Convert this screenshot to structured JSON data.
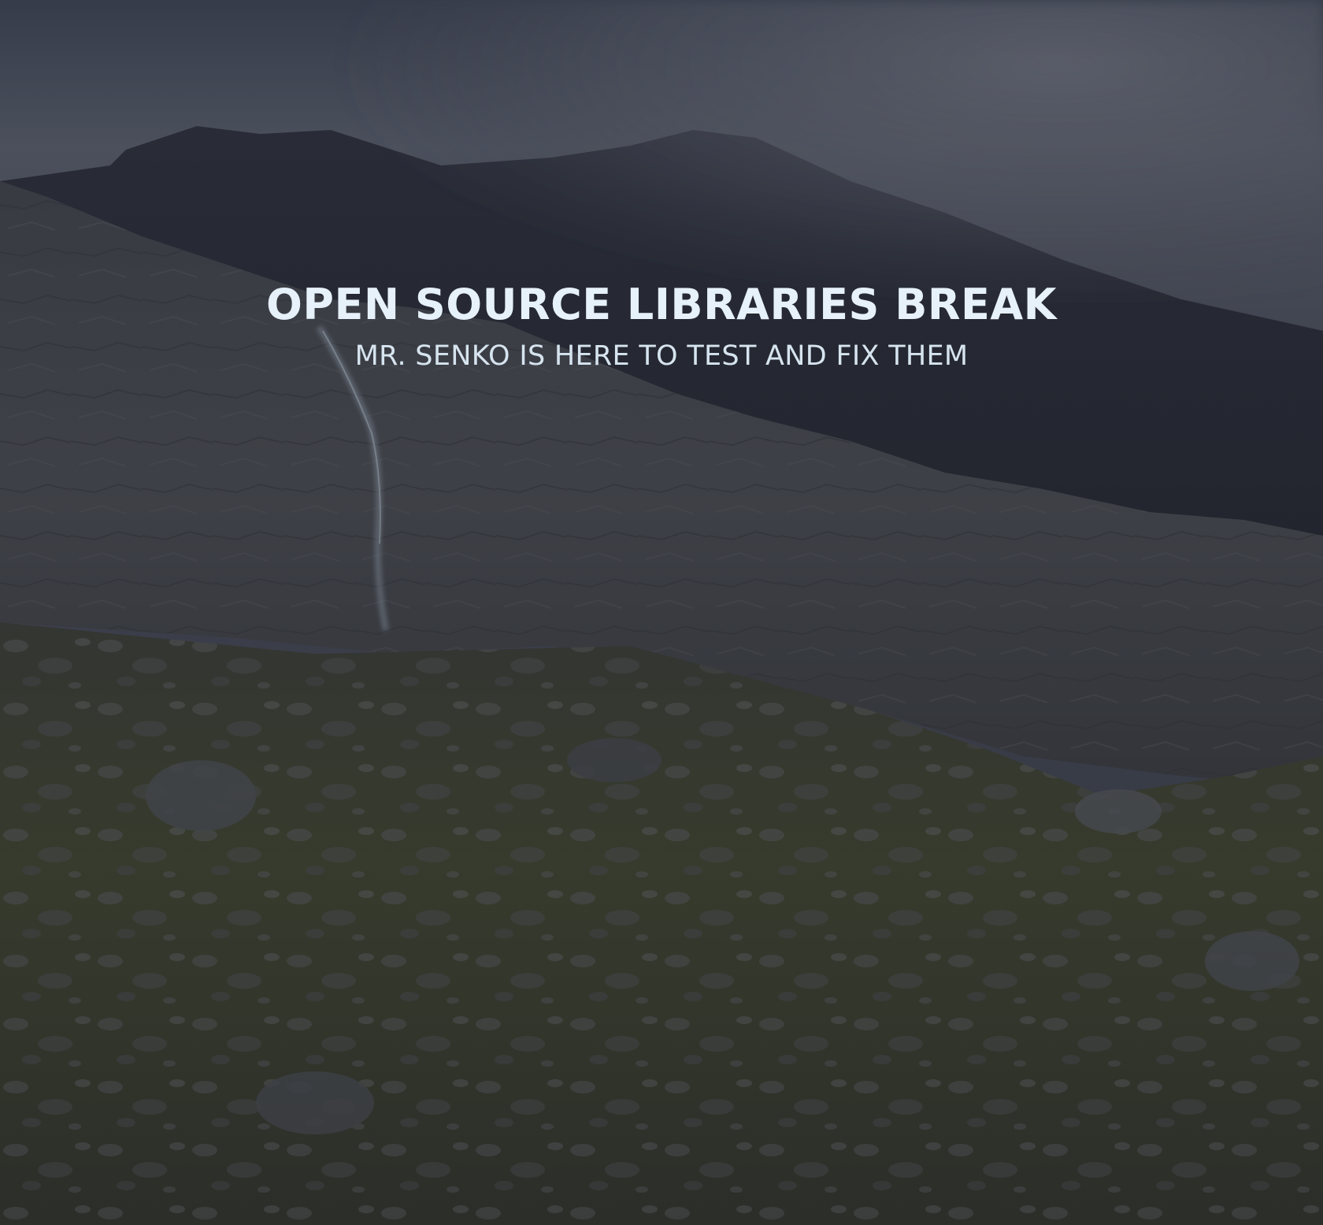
{
  "hero": {
    "title": "OPEN SOURCE LIBRARIES BREAK",
    "subtitle": "MR. SENKO IS HERE TO TEST AND FIX THEM",
    "background": "misty-mountain-landscape-photo"
  },
  "colors": {
    "title": "#e6f1fa",
    "subtitle": "#d6e4ef",
    "sky": "#4d5260",
    "mountain": "#2b2e3a",
    "cliff": "#46484f",
    "grass": "#3e4231"
  }
}
